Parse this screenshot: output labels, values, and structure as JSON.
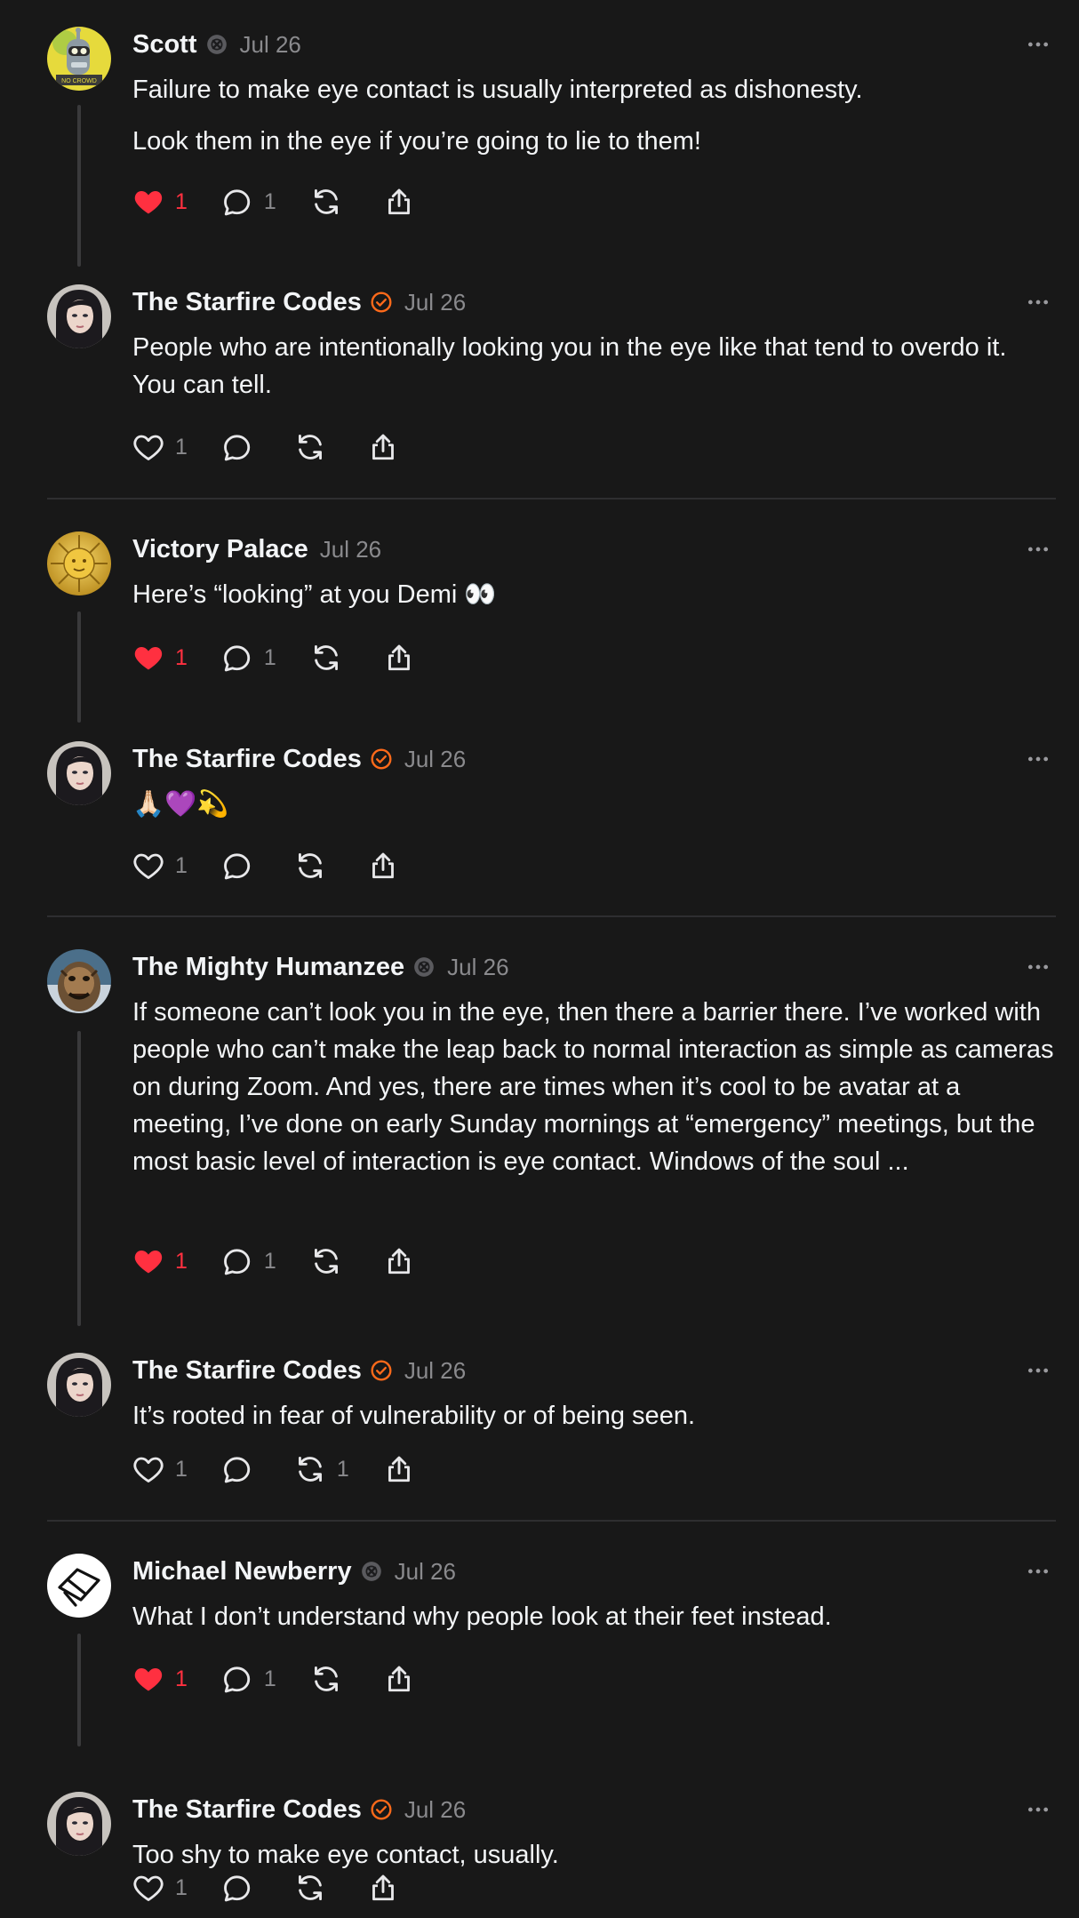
{
  "colors": {
    "background": "#181818",
    "text": "#f3f5f7",
    "muted": "#8a8a8d",
    "like_red": "#ff3040",
    "verified_orange": "#ff6a1a",
    "thread_line": "#3a3a3c"
  },
  "posts": [
    {
      "name": "Scott",
      "badge": "blocked-badge-icon",
      "time": "Jul 26",
      "paragraphs": [
        "Failure to make eye contact is usually interpreted as dishonesty.",
        "Look them in the eye if you’re going to lie to them!"
      ],
      "likes": "1",
      "liked": true,
      "replies": "1",
      "reposts": "",
      "avatar": "robot-avatar"
    },
    {
      "name": "The Starfire Codes",
      "badge": "verified-badge-icon",
      "time": "Jul 26",
      "paragraphs": [
        "People who are intentionally looking you in the eye like that tend to overdo it. You can tell."
      ],
      "likes": "1",
      "liked": false,
      "replies": "",
      "reposts": "",
      "avatar": "woman-avatar"
    },
    {
      "name": "Victory Palace",
      "badge": "",
      "time": "Jul 26",
      "paragraphs": [
        "Here’s “looking” at you Demi 👀"
      ],
      "likes": "1",
      "liked": true,
      "replies": "1",
      "reposts": "",
      "avatar": "sun-avatar"
    },
    {
      "name": "The Starfire Codes",
      "badge": "verified-badge-icon",
      "time": "Jul 26",
      "paragraphs": [
        "🙏🏻💜💫"
      ],
      "likes": "1",
      "liked": false,
      "replies": "",
      "reposts": "",
      "avatar": "woman-avatar"
    },
    {
      "name": "The Mighty Humanzee",
      "badge": "blocked-badge-icon",
      "time": "Jul 26",
      "paragraphs": [
        "If someone can’t look you in the eye, then there a barrier there. I’ve worked with people who can’t make the leap back to normal interaction as simple as cameras on during Zoom. And yes, there are times when it’s cool to be avatar at a meeting, I’ve done on early Sunday mornings at “emergency” meetings, but the most basic level of interaction is eye contact. Windows of the soul ..."
      ],
      "likes": "1",
      "liked": true,
      "replies": "1",
      "reposts": "",
      "avatar": "creature-avatar"
    },
    {
      "name": "The Starfire Codes",
      "badge": "verified-badge-icon",
      "time": "Jul 26",
      "paragraphs": [
        "It’s rooted in fear of vulnerability or of being seen."
      ],
      "likes": "1",
      "liked": false,
      "replies": "",
      "reposts": "1",
      "avatar": "woman-avatar"
    },
    {
      "name": "Michael Newberry",
      "badge": "blocked-badge-icon",
      "time": "Jul 26",
      "paragraphs": [
        "What I don’t understand why people look at their feet instead."
      ],
      "likes": "1",
      "liked": true,
      "replies": "1",
      "reposts": "",
      "avatar": "shape-logo-avatar"
    },
    {
      "name": "The Starfire Codes",
      "badge": "verified-badge-icon",
      "time": "Jul 26",
      "paragraphs": [
        "Too shy to make eye contact, usually."
      ],
      "likes": "1",
      "liked": false,
      "replies": "",
      "reposts": "",
      "avatar": "woman-avatar"
    }
  ]
}
